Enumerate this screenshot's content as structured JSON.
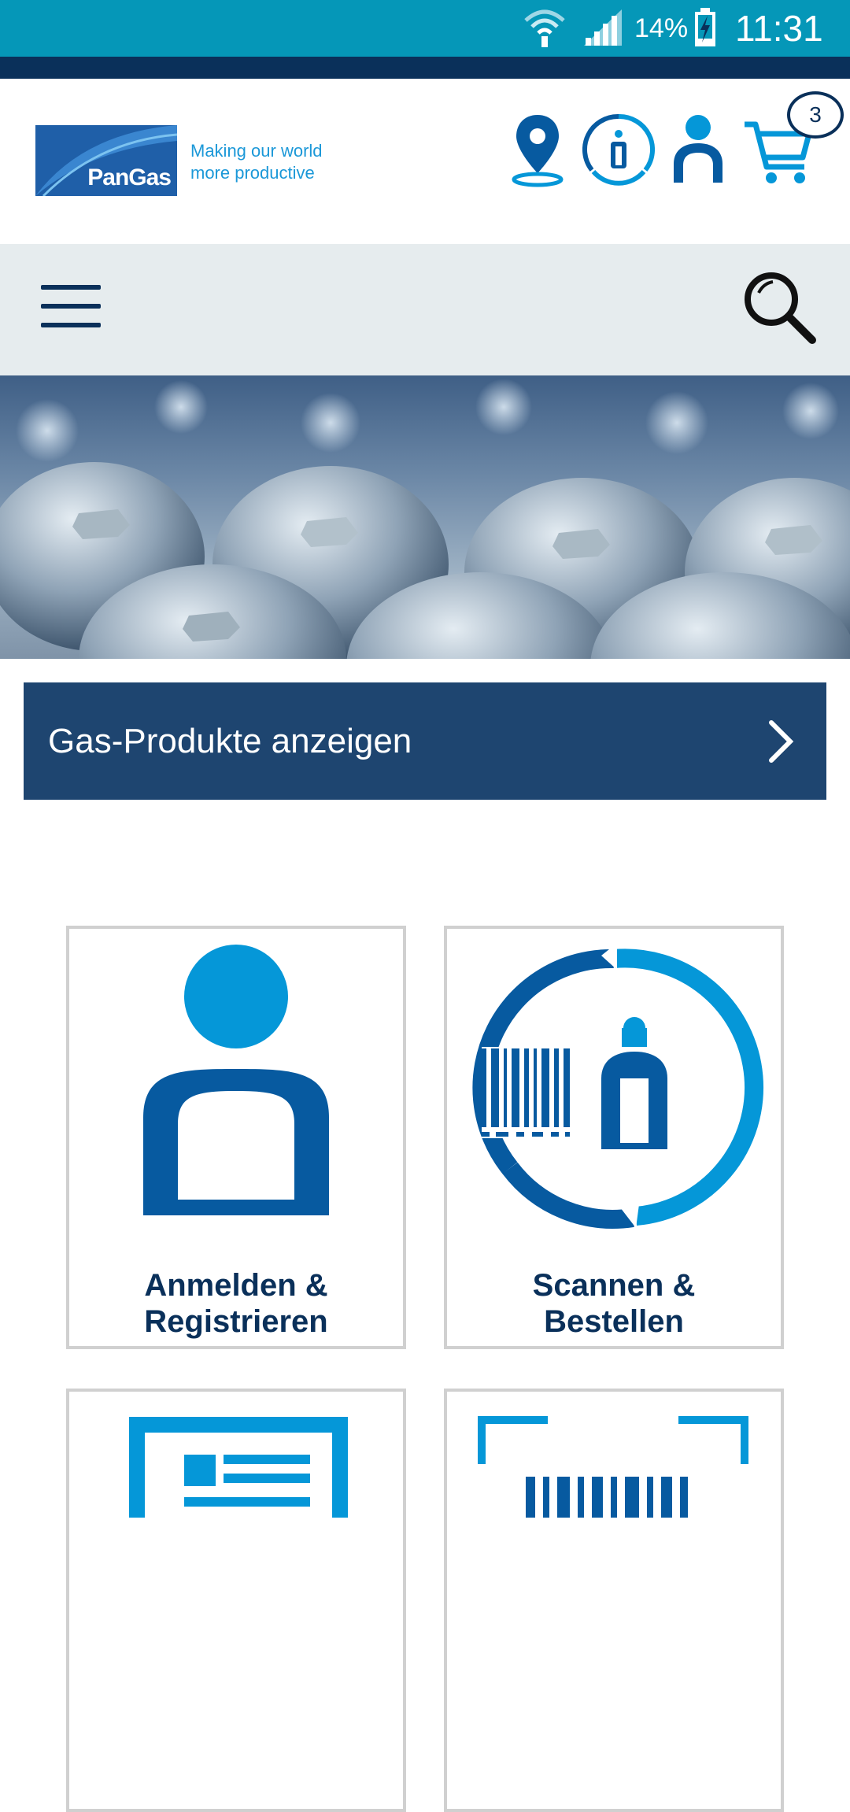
{
  "status_bar": {
    "battery": "14%",
    "time": "11:31"
  },
  "brand": {
    "logo_text": "PanGas",
    "tagline_line1": "Making our world",
    "tagline_line2": "more productive"
  },
  "header": {
    "cart_count": "3"
  },
  "cta": {
    "label": "Gas-Produkte anzeigen"
  },
  "tiles": [
    {
      "line1": "Anmelden &",
      "line2": "Registrieren"
    },
    {
      "line1": "Scannen &",
      "line2": "Bestellen"
    }
  ],
  "colors": {
    "primary_navy": "#1e4570",
    "accent_blue": "#0597d8",
    "dark_blue": "#075aa0",
    "status_teal": "#0597b8"
  },
  "icons": [
    "wifi-icon",
    "signal-icon",
    "battery-charging-icon",
    "location-pin-icon",
    "cylinder-info-icon",
    "user-icon",
    "cart-icon",
    "menu-icon",
    "search-icon",
    "chevron-right-icon",
    "barcode-icon",
    "document-icon"
  ]
}
